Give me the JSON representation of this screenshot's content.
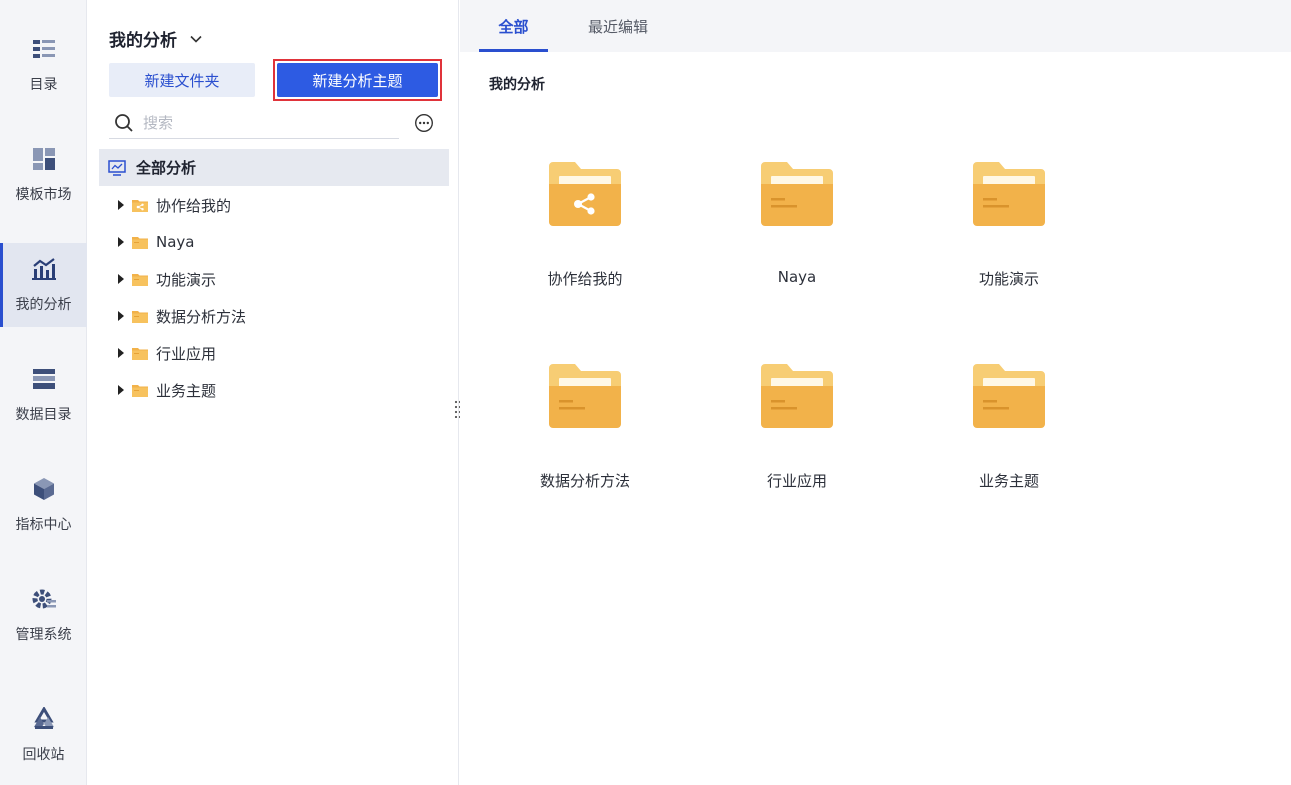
{
  "nav": {
    "items": [
      {
        "label": "目录",
        "icon": "catalog-icon",
        "active": false
      },
      {
        "label": "模板市场",
        "icon": "template-market-icon",
        "active": false
      },
      {
        "label": "我的分析",
        "icon": "my-analysis-icon",
        "active": true
      },
      {
        "label": "数据目录",
        "icon": "data-catalog-icon",
        "active": false
      },
      {
        "label": "指标中心",
        "icon": "metrics-center-icon",
        "active": false
      },
      {
        "label": "管理系统",
        "icon": "admin-system-icon",
        "active": false
      },
      {
        "label": "回收站",
        "icon": "recycle-bin-icon",
        "active": false
      }
    ]
  },
  "panel": {
    "title": "我的分析",
    "new_folder_label": "新建文件夹",
    "new_topic_label": "新建分析主题",
    "search_placeholder": "搜索",
    "root_label": "全部分析",
    "tree": [
      {
        "label": "协作给我的",
        "icon": "shared-folder-icon"
      },
      {
        "label": "Naya",
        "icon": "folder-icon"
      },
      {
        "label": "功能演示",
        "icon": "folder-icon"
      },
      {
        "label": "数据分析方法",
        "icon": "folder-icon"
      },
      {
        "label": "行业应用",
        "icon": "folder-icon"
      },
      {
        "label": "业务主题",
        "icon": "folder-icon"
      }
    ]
  },
  "main": {
    "tabs": [
      {
        "label": "全部",
        "active": true
      },
      {
        "label": "最近编辑",
        "active": false
      }
    ],
    "section_title": "我的分析",
    "folders": [
      {
        "label": "协作给我的",
        "shared": true
      },
      {
        "label": "Naya",
        "shared": false
      },
      {
        "label": "功能演示",
        "shared": false
      },
      {
        "label": "数据分析方法",
        "shared": false
      },
      {
        "label": "行业应用",
        "shared": false
      },
      {
        "label": "业务主题",
        "shared": false
      }
    ]
  },
  "colors": {
    "accent": "#2d5be3",
    "folder_back": "#f7cd74",
    "folder_front": "#f2b24a",
    "highlight_border": "#e0333a"
  }
}
